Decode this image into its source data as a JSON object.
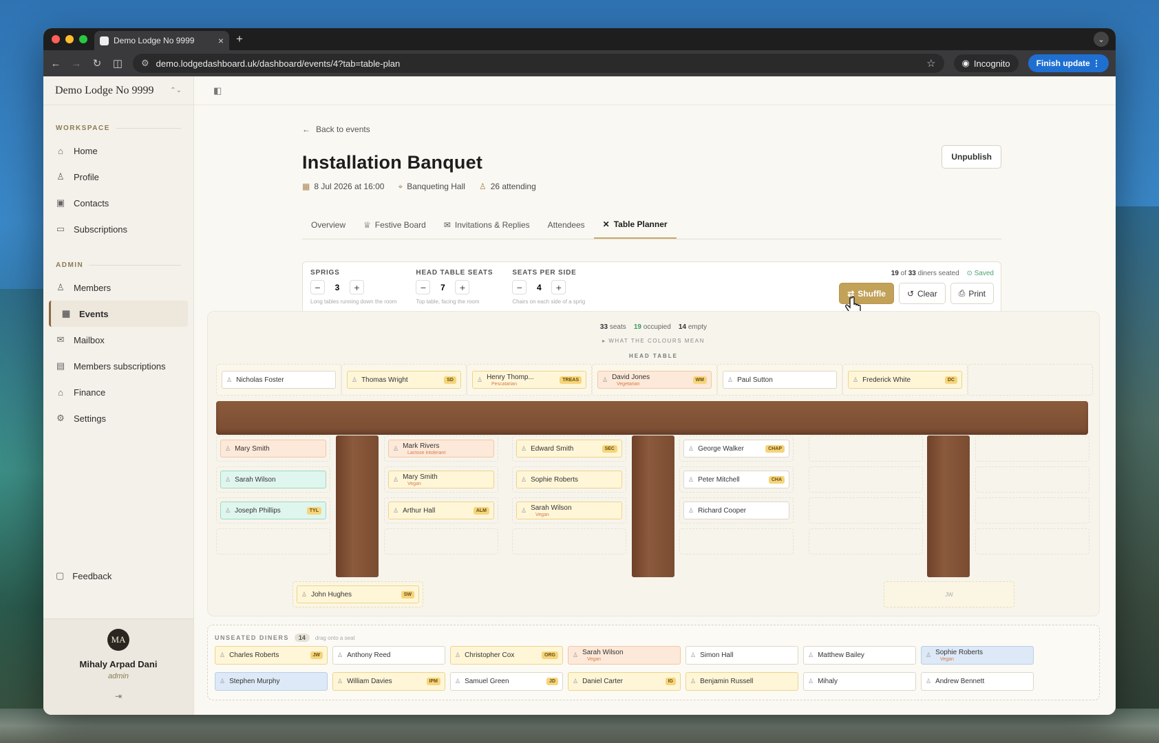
{
  "browser": {
    "tab_title": "Demo Lodge No 9999",
    "url": "demo.lodgedashboard.uk/dashboard/events/4?tab=table-plan",
    "incognito_label": "Incognito",
    "finish_update_label": "Finish update"
  },
  "sidebar": {
    "lodge_name": "Demo Lodge No 9999",
    "workspace_label": "WORKSPACE",
    "workspace_items": [
      {
        "label": "Home",
        "icon": "home-icon"
      },
      {
        "label": "Profile",
        "icon": "user-icon"
      },
      {
        "label": "Contacts",
        "icon": "contacts-icon"
      },
      {
        "label": "Subscriptions",
        "icon": "card-icon"
      }
    ],
    "admin_label": "ADMIN",
    "admin_items": [
      {
        "label": "Members",
        "icon": "users-icon"
      },
      {
        "label": "Events",
        "icon": "calendar-icon"
      },
      {
        "label": "Mailbox",
        "icon": "inbox-icon"
      },
      {
        "label": "Members subscriptions",
        "icon": "receipt-icon"
      },
      {
        "label": "Finance",
        "icon": "bank-icon"
      },
      {
        "label": "Settings",
        "icon": "gear-icon"
      }
    ],
    "feedback_label": "Feedback",
    "user": {
      "initials": "MA",
      "name": "Mihaly Arpad Dani",
      "role": "admin"
    }
  },
  "event": {
    "back_label": "Back to events",
    "title": "Installation Banquet",
    "date": "8 Jul 2026 at 16:00",
    "venue": "Banqueting Hall",
    "attending": "26 attending",
    "unpublish_label": "Unpublish",
    "tabs": [
      "Overview",
      "Festive Board",
      "Invitations & Replies",
      "Attendees",
      "Table Planner"
    ]
  },
  "controls": {
    "sprigs": {
      "label": "SPRIGS",
      "value": "3",
      "hint": "Long tables running down the room"
    },
    "head_seats": {
      "label": "HEAD TABLE SEATS",
      "value": "7",
      "hint": "Top table, facing the room"
    },
    "per_side": {
      "label": "SEATS PER SIDE",
      "value": "4",
      "hint": "Chairs on each side of a sprig"
    },
    "seated_count": "19",
    "seated_of": "of",
    "seated_total": "33",
    "seated_suffix": "diners seated",
    "saved_label": "Saved",
    "shuffle_label": "Shuffle",
    "clear_label": "Clear",
    "print_label": "Print"
  },
  "plan": {
    "seats_count": "33",
    "seats_label": "seats",
    "occupied_count": "19",
    "occupied_label": "occupied",
    "empty_count": "14",
    "empty_label": "empty",
    "legend_label": "▸ WHAT THE COLOURS MEAN",
    "head_table_label": "HEAD TABLE",
    "head": [
      {
        "name": "Nicholas Foster",
        "badge": "",
        "sub": "",
        "color": "white"
      },
      {
        "name": "Thomas Wright",
        "badge": "SD",
        "sub": "",
        "color": "yellow"
      },
      {
        "name": "Henry Thomp...",
        "badge": "TREAS",
        "sub": "Pescatarian",
        "color": "yellow"
      },
      {
        "name": "David Jones",
        "badge": "WM",
        "sub": "Vegetarian",
        "color": "peach"
      },
      {
        "name": "Paul Sutton",
        "badge": "",
        "sub": "",
        "color": "white"
      },
      {
        "name": "Frederick White",
        "badge": "DC",
        "sub": "",
        "color": "yellow"
      }
    ],
    "col1": [
      {
        "name": "Mary Smith",
        "badge": "",
        "sub": "",
        "color": "peach"
      },
      {
        "name": "Sarah Wilson",
        "badge": "",
        "sub": "",
        "color": "cyan"
      },
      {
        "name": "Joseph Phillips",
        "badge": "TYL",
        "sub": "",
        "color": "cyan"
      }
    ],
    "col2": [
      {
        "name": "Mark Rivers",
        "badge": "",
        "sub": "Lactose intolerant",
        "color": "peach"
      },
      {
        "name": "Mary Smith",
        "badge": "",
        "sub": "Vegan",
        "color": "yellow"
      },
      {
        "name": "Arthur Hall",
        "badge": "ALM",
        "sub": "",
        "color": "yellow"
      }
    ],
    "col3": [
      {
        "name": "Edward Smith",
        "badge": "SEC",
        "sub": "",
        "color": "yellow"
      },
      {
        "name": "Sophie Roberts",
        "badge": "",
        "sub": "",
        "color": "yellow"
      },
      {
        "name": "Sarah Wilson",
        "badge": "",
        "sub": "Vegan",
        "color": "yellow"
      }
    ],
    "col4": [
      {
        "name": "George Walker",
        "badge": "CHAP",
        "sub": "",
        "color": "white"
      },
      {
        "name": "Peter Mitchell",
        "badge": "CHA",
        "sub": "",
        "color": "white"
      },
      {
        "name": "Richard Cooper",
        "badge": "",
        "sub": "",
        "color": "white"
      }
    ],
    "foot1": {
      "name": "John Hughes",
      "badge": "SW",
      "sub": "",
      "color": "yellow"
    },
    "foot3_placeholder": "JW"
  },
  "unseated": {
    "label": "UNSEATED DINERS",
    "count": "14",
    "hint": "drag onto a seat",
    "row1": [
      {
        "name": "Charles Roberts",
        "badge": "JW",
        "sub": "",
        "color": "yellow"
      },
      {
        "name": "Anthony Reed",
        "badge": "",
        "sub": "",
        "color": "white"
      },
      {
        "name": "Christopher Cox",
        "badge": "ORG",
        "sub": "",
        "color": "yellow"
      },
      {
        "name": "Sarah Wilson",
        "badge": "",
        "sub": "Vegan",
        "color": "peach"
      },
      {
        "name": "Simon Hall",
        "badge": "",
        "sub": "",
        "color": "white"
      },
      {
        "name": "Matthew Bailey",
        "badge": "",
        "sub": "",
        "color": "white"
      },
      {
        "name": "Sophie Roberts",
        "badge": "",
        "sub": "Vegan",
        "color": "blue"
      }
    ],
    "row2": [
      {
        "name": "Stephen Murphy",
        "badge": "",
        "sub": "",
        "color": "blue"
      },
      {
        "name": "William Davies",
        "badge": "IPM",
        "sub": "",
        "color": "yellow"
      },
      {
        "name": "Samuel Green",
        "badge": "JD",
        "sub": "",
        "color": "white"
      },
      {
        "name": "Daniel Carter",
        "badge": "IG",
        "sub": "",
        "color": "yellow"
      },
      {
        "name": "Benjamin Russell",
        "badge": "",
        "sub": "",
        "color": "yellow"
      },
      {
        "name": "Mihaly",
        "badge": "",
        "sub": "",
        "color": "white"
      },
      {
        "name": "Andrew Bennett",
        "badge": "",
        "sub": "",
        "color": "white"
      }
    ]
  }
}
